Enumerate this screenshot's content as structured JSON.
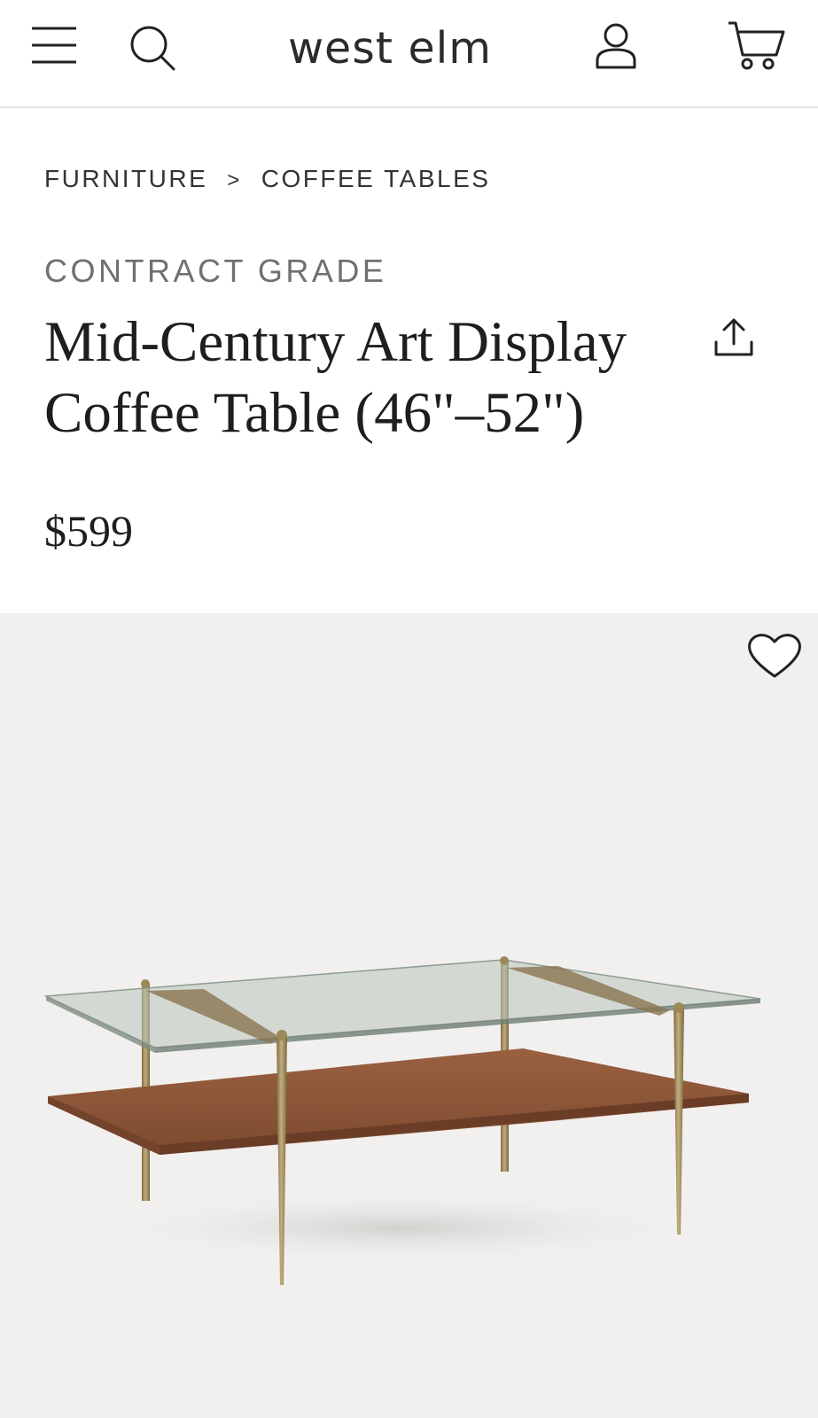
{
  "header": {
    "logo": "west elm",
    "icons": [
      "menu-icon",
      "search-icon",
      "account-icon",
      "cart-icon"
    ]
  },
  "breadcrumb": {
    "items": [
      "FURNITURE",
      "COFFEE TABLES"
    ],
    "separator": ">"
  },
  "product": {
    "eyebrow": "CONTRACT GRADE",
    "title_line1": "Mid-Century Art Display",
    "title_line2": "Coffee Table (46\"–52\")",
    "price": "$599"
  },
  "gallery": {
    "icons": [
      "heart-icon",
      "share-icon"
    ]
  },
  "colors": {
    "header_border": "#e2e2e2",
    "gallery_bg": "#f1f0ef",
    "walnut": "#8a5438",
    "brass": "#a08b5c"
  }
}
